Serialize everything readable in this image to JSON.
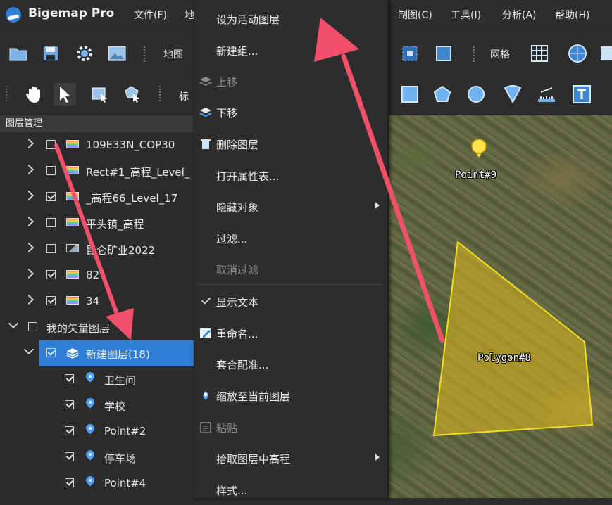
{
  "app": {
    "title": "Bigemap Pro"
  },
  "menubar": {
    "left_items": [
      "文件(F)",
      "地"
    ],
    "right_items": [
      "制图(C)",
      "工具(I)",
      "分析(A)",
      "帮助(H)"
    ]
  },
  "toolbar1": {
    "map_label": "地图",
    "grid_label": "网格"
  },
  "toolbar2": {
    "mark_label": "标"
  },
  "layer_panel": {
    "title": "图层管理",
    "rows": [
      {
        "label": "109E33N_COP30",
        "checked": false,
        "expander": "right",
        "icon": "raster"
      },
      {
        "label": "Rect#1_高程_Level_",
        "checked": false,
        "expander": "right",
        "icon": "raster"
      },
      {
        "label": "_高程66_Level_17",
        "checked": true,
        "expander": "right",
        "icon": "raster"
      },
      {
        "label": "平头镇_高程",
        "checked": false,
        "expander": "right",
        "icon": "raster"
      },
      {
        "label": "昆仑矿业2022",
        "checked": false,
        "expander": "right",
        "icon": "image"
      },
      {
        "label": "82",
        "checked": true,
        "expander": "right",
        "icon": "raster"
      },
      {
        "label": "34",
        "checked": true,
        "expander": "right",
        "icon": "raster"
      },
      {
        "label": "我的矢量图层",
        "checked": false,
        "expander": "down",
        "icon": "none"
      },
      {
        "label": "新建图层(18)",
        "checked": true,
        "expander": "down",
        "icon": "layers",
        "selected": true
      },
      {
        "label": "卫生间",
        "checked": true,
        "expander": "none",
        "icon": "pin"
      },
      {
        "label": "学校",
        "checked": true,
        "expander": "none",
        "icon": "pin"
      },
      {
        "label": "Point#2",
        "checked": true,
        "expander": "none",
        "icon": "pin"
      },
      {
        "label": "停车场",
        "checked": true,
        "expander": "none",
        "icon": "pin"
      },
      {
        "label": "Point#4",
        "checked": true,
        "expander": "none",
        "icon": "pin"
      }
    ]
  },
  "context_menu": {
    "items": [
      {
        "label": "设为活动图层",
        "enabled": true
      },
      {
        "label": "新建组...",
        "enabled": true
      },
      {
        "label": "上移",
        "enabled": false,
        "icon": "layers-up-icon"
      },
      {
        "label": "下移",
        "enabled": true,
        "icon": "layers-down-icon"
      },
      {
        "label": "删除图层",
        "enabled": true,
        "icon": "trash-icon"
      },
      {
        "label": "打开属性表...",
        "enabled": true
      },
      {
        "label": "隐藏对象",
        "enabled": true,
        "submenu": true
      },
      {
        "label": "过滤...",
        "enabled": true
      },
      {
        "label": "取消过滤",
        "enabled": false
      },
      {
        "label": "显示文本",
        "enabled": true,
        "checked": true
      },
      {
        "label": "重命名...",
        "enabled": true,
        "icon": "rename-icon"
      },
      {
        "label": "套合配准...",
        "enabled": true
      },
      {
        "label": "缩放至当前图层",
        "enabled": true,
        "icon": "zoom-pin-icon"
      },
      {
        "label": "粘贴",
        "enabled": false,
        "icon": "paste-icon"
      },
      {
        "label": "拾取图层中高程",
        "enabled": true,
        "submenu": true
      },
      {
        "label": "样式...",
        "enabled": true
      }
    ]
  },
  "map": {
    "point_label": "Point#9",
    "polygon_label": "Polygon#8",
    "colors": {
      "polygon_fill": "#d4b21e",
      "polygon_stroke": "#f0e020",
      "pin": "#ffe54a",
      "annotation_arrow": "#f0506a"
    }
  }
}
